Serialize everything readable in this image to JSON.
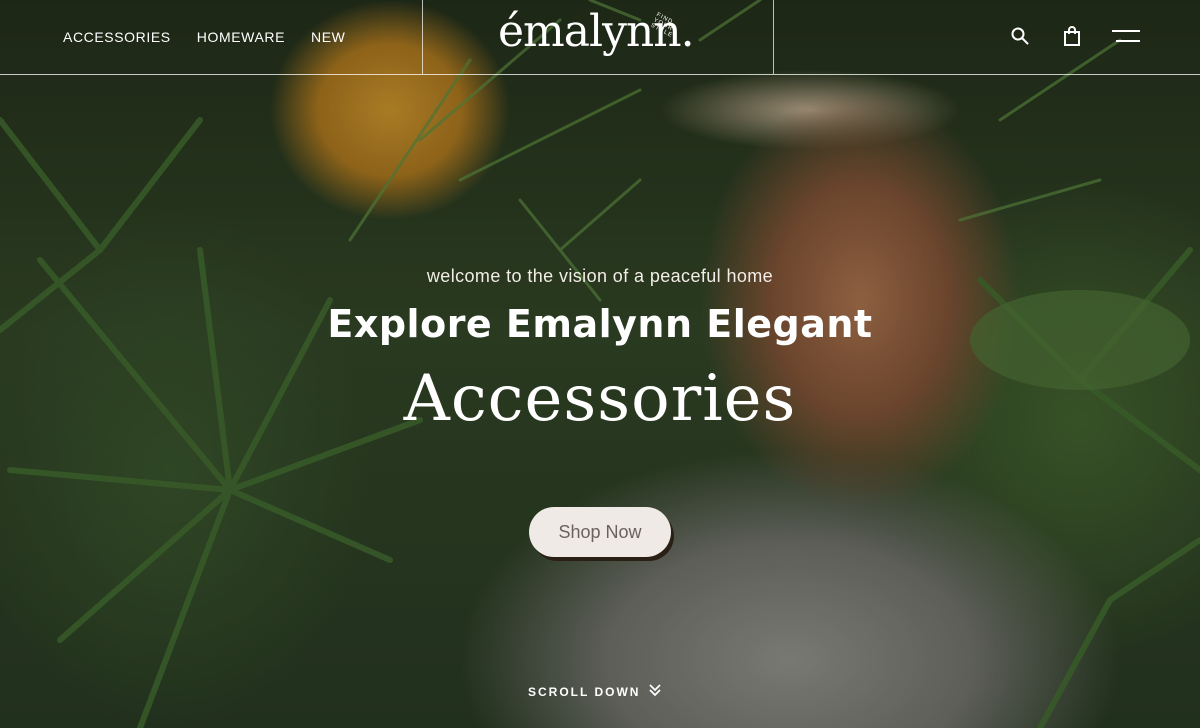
{
  "header": {
    "nav": [
      "ACCESSORIES",
      "HOMEWARE",
      "NEW"
    ],
    "logo": {
      "wordmark": "émalynn.",
      "tagline": "FIND YOUR STYLE"
    },
    "icons": [
      "search-icon",
      "shopping-bag-icon",
      "menu-icon"
    ]
  },
  "hero": {
    "subtitle": "welcome to the vision of a peaceful home",
    "headline": "Explore Emalynn Elegant",
    "category": "Accessories",
    "cta_label": "Shop Now",
    "scroll_label": "SCROLL DOWN"
  },
  "colors": {
    "text": "#ffffff",
    "button_bg": "#efeae6",
    "button_text": "#6a625c",
    "button_shadow": "#2a2016"
  }
}
